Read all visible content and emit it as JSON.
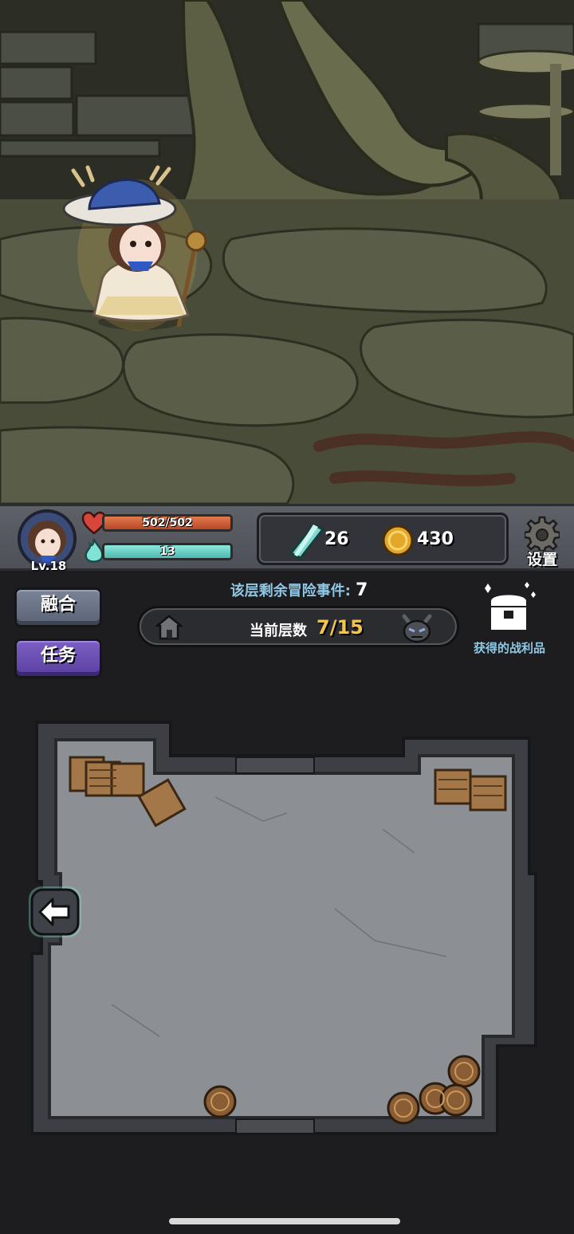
{
  "hud": {
    "level": "Lv.18",
    "hp": {
      "text": "502/502",
      "current": 502,
      "max": 502
    },
    "mana": {
      "text": "13",
      "fill_fraction": 1.0
    },
    "crystals": "26",
    "coins": "430",
    "settings_label": "设置"
  },
  "panel": {
    "fuse_label": "融合",
    "task_label": "任务",
    "events_label": "该层剩余冒险事件:",
    "events_count": "7",
    "floor_label": "当前层数",
    "floor_value": "7/15",
    "loot_label": "获得的战利品"
  },
  "icons": {
    "heart": "heart-icon",
    "mana": "soul-flame-icon",
    "crystal": "crystal-icon",
    "coin": "coin-icon",
    "settings": "gear-icon",
    "floor_start": "house-icon",
    "floor_end": "demon-icon",
    "loot": "treasure-chest-icon",
    "back": "left-arrow-icon"
  },
  "colors": {
    "hp": "#d3613a",
    "mana": "#72d4c8",
    "floor_value": "#f2c64a",
    "info_text": "#8fc7e4",
    "fuse_button": "#6b7386",
    "task_button": "#6a4fb4"
  }
}
